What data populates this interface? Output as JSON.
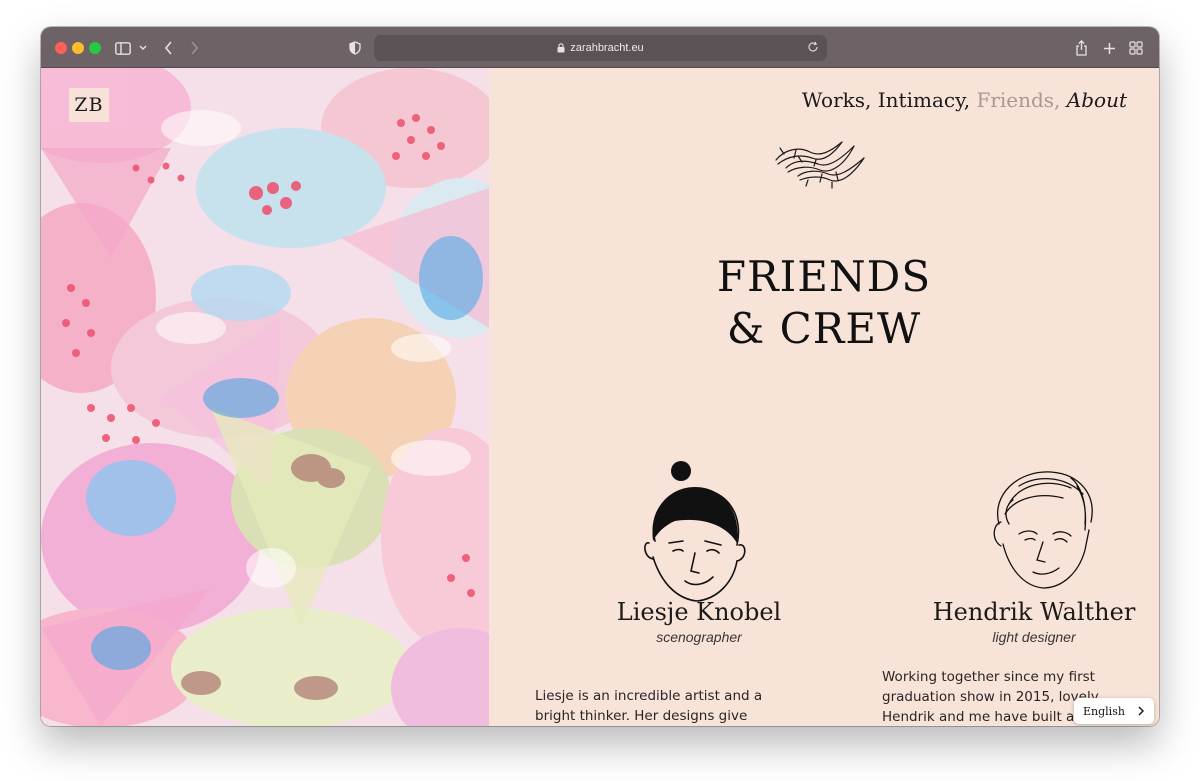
{
  "browser": {
    "url": "zarahbracht.eu",
    "icons": [
      "sidebar-icon",
      "chevron-down-icon",
      "back-icon",
      "forward-icon",
      "shield-icon",
      "lock-icon",
      "reload-icon",
      "share-icon",
      "new-tab-icon",
      "tab-overview-icon"
    ]
  },
  "site": {
    "logo": "ZB",
    "nav": {
      "works": "Works,",
      "intimacy": "Intimacy,",
      "friends": "Friends,",
      "about": "About"
    },
    "heading_line1": "FRIENDS",
    "heading_line2": "& CREW",
    "people": [
      {
        "name": "Liesje Knobel",
        "role": "scenographer",
        "bio": "Liesje is an incredible artist and a bright thinker. Her designs give"
      },
      {
        "name": "Hendrik Walther",
        "role": "light designer",
        "bio": "Working together since my first graduation show in 2015, lovely Hendrik and me have built a"
      }
    ],
    "language": "English"
  },
  "colors": {
    "page_bg": "#f8e3d8",
    "toolbar": "#6d6367",
    "nav_active": "#a99893",
    "text": "#1e1a1a"
  }
}
